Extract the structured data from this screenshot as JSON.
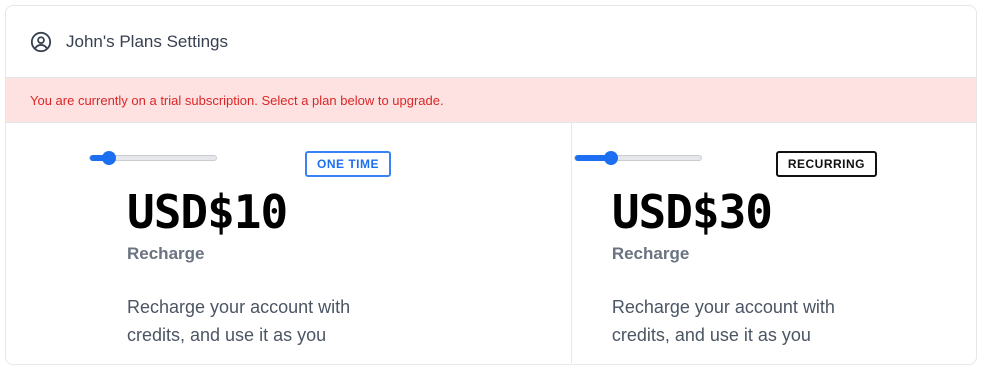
{
  "header": {
    "title": "John's Plans Settings",
    "icon": "user-circle-icon"
  },
  "alert": {
    "message": "You are currently on a trial subscription. Select a plan below to upgrade.",
    "background": "#fee2e2",
    "text_color": "#dc2626"
  },
  "plans": [
    {
      "badge": "ONE TIME",
      "price": "USD$10",
      "name": "Recharge",
      "description": "Recharge your account with credits, and use it as you",
      "slider_level": 0.15,
      "accent": "#1d6ff2"
    },
    {
      "badge": "RECURRING",
      "price": "USD$30",
      "name": "Recharge",
      "description": "Recharge your account with credits, and use it as you",
      "slider_level": 0.28,
      "accent": "#111111"
    }
  ]
}
